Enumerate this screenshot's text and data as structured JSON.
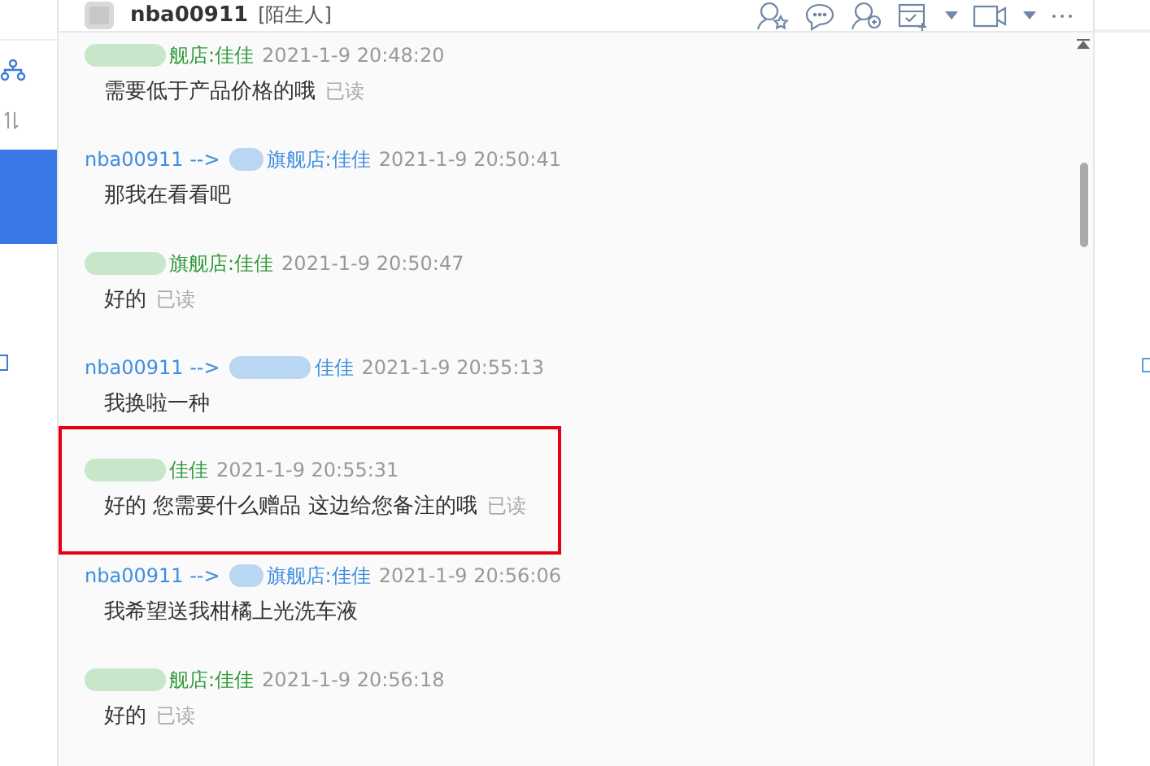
{
  "chat": {
    "title": "nba00911",
    "tag": "[陌生人]"
  },
  "messages": [
    {
      "kind": "out",
      "sender": "舰店:佳佳",
      "time": "2021-1-9 20:48:20",
      "text": "需要低于产品价格的哦",
      "status": "已读",
      "highlighted": false
    },
    {
      "kind": "in",
      "sender_prefix": "nba00911 -->",
      "sender": "旗舰店:佳佳",
      "time": "2021-1-9 20:50:41",
      "text": "那我在看看吧",
      "highlighted": false
    },
    {
      "kind": "out",
      "sender": "旗舰店:佳佳",
      "time": "2021-1-9 20:50:47",
      "text": "好的",
      "status": "已读",
      "highlighted": false
    },
    {
      "kind": "in",
      "sender_prefix": "nba00911 -->",
      "sender": "佳佳",
      "time": "2021-1-9 20:55:13",
      "text": "我换啦一种",
      "highlighted": false
    },
    {
      "kind": "out",
      "sender": "佳佳",
      "time": "2021-1-9 20:55:31",
      "text": "好的 您需要什么赠品 这边给您备注的哦",
      "status": "已读",
      "highlighted": true
    },
    {
      "kind": "in",
      "sender_prefix": "nba00911 -->",
      "sender": "旗舰店:佳佳",
      "time": "2021-1-9 20:56:06",
      "text": "我希望送我柑橘上光洗车液",
      "highlighted": false
    },
    {
      "kind": "out",
      "sender": "舰店:佳佳",
      "time": "2021-1-9 20:56:18",
      "text": "好的",
      "status": "已读",
      "highlighted": false
    }
  ]
}
